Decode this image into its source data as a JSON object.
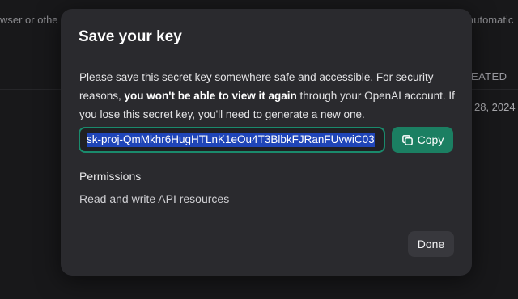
{
  "background": {
    "left_fragment": "wser or othe",
    "right_fragment": "automatic",
    "column_header": "EATED",
    "date_fragment": "28, 2024"
  },
  "modal": {
    "title": "Save your key",
    "description": {
      "part1": "Please save this secret key somewhere safe and accessible. For security reasons, ",
      "bold": "you won't be able to view it again",
      "part2": " through your OpenAI account. If you lose this secret key, you'll need to generate a new one."
    },
    "key_value": "sk-proj-QmMkhr6HugHTLnK1eOu4T3BlbkFJRanFUvwiC03",
    "copy_label": "Copy",
    "permissions_label": "Permissions",
    "permissions_value": "Read and write API resources",
    "done_label": "Done"
  },
  "colors": {
    "accent": "#1b7f62",
    "modal_bg": "#2a2a2e",
    "selection": "#1f45b8"
  },
  "icons": {
    "copy": "copy-icon"
  }
}
